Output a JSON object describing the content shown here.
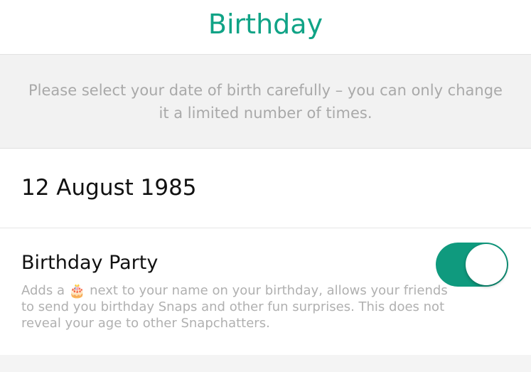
{
  "header": {
    "title": "Birthday"
  },
  "notice": {
    "text": "Please select your date of birth carefully – you can only change it a limited number of times."
  },
  "birthday": {
    "date": "12 August 1985"
  },
  "party": {
    "label": "Birthday Party",
    "desc_before": "Adds a ",
    "desc_icon": "🎂",
    "desc_after": " next to your name on your birthday, allows your friends to send you birthday Snaps and other fun surprises. This does not reveal your age to other Snapchatters.",
    "toggle_on": true
  },
  "colors": {
    "accent": "#10a386",
    "toggle_on": "#0f9a7e"
  }
}
